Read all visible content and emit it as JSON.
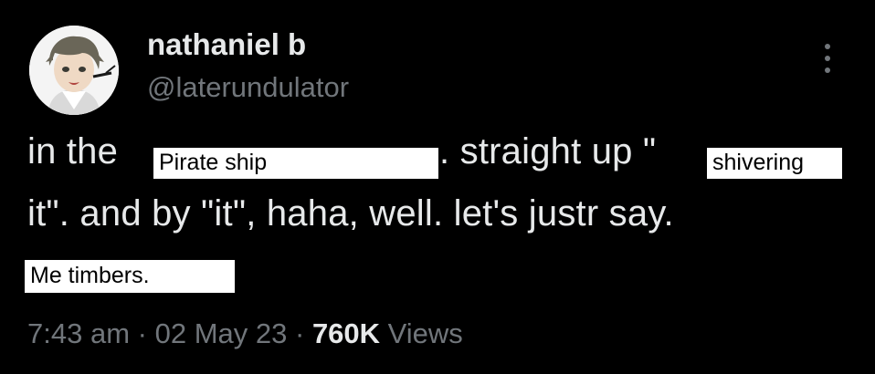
{
  "author": {
    "display_name": "nathaniel b",
    "handle": "@laterundulator"
  },
  "tweet": {
    "line1_prefix": "in the",
    "overlay_pirate": "Pirate ship",
    "line1_middle": ". straight up \"",
    "overlay_shivering": "shivering",
    "line2": "it\". and by \"it\", haha, well. let's justr say.",
    "overlay_timbers": "Me timbers."
  },
  "meta": {
    "time": "7:43 am",
    "separator": "·",
    "date": "02 May 23",
    "views_count": "760K",
    "views_label": "Views"
  },
  "icons": {
    "more": "more-vertical-icon",
    "avatar": "avatar"
  }
}
